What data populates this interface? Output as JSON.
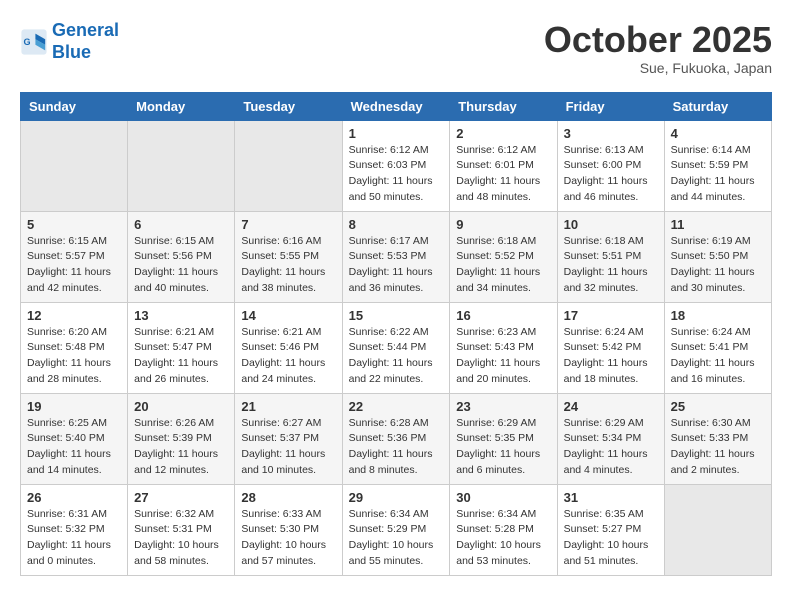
{
  "header": {
    "logo_line1": "General",
    "logo_line2": "Blue",
    "month": "October 2025",
    "location": "Sue, Fukuoka, Japan"
  },
  "days_of_week": [
    "Sunday",
    "Monday",
    "Tuesday",
    "Wednesday",
    "Thursday",
    "Friday",
    "Saturday"
  ],
  "weeks": [
    [
      {
        "day": "",
        "info": ""
      },
      {
        "day": "",
        "info": ""
      },
      {
        "day": "",
        "info": ""
      },
      {
        "day": "1",
        "info": "Sunrise: 6:12 AM\nSunset: 6:03 PM\nDaylight: 11 hours\nand 50 minutes."
      },
      {
        "day": "2",
        "info": "Sunrise: 6:12 AM\nSunset: 6:01 PM\nDaylight: 11 hours\nand 48 minutes."
      },
      {
        "day": "3",
        "info": "Sunrise: 6:13 AM\nSunset: 6:00 PM\nDaylight: 11 hours\nand 46 minutes."
      },
      {
        "day": "4",
        "info": "Sunrise: 6:14 AM\nSunset: 5:59 PM\nDaylight: 11 hours\nand 44 minutes."
      }
    ],
    [
      {
        "day": "5",
        "info": "Sunrise: 6:15 AM\nSunset: 5:57 PM\nDaylight: 11 hours\nand 42 minutes."
      },
      {
        "day": "6",
        "info": "Sunrise: 6:15 AM\nSunset: 5:56 PM\nDaylight: 11 hours\nand 40 minutes."
      },
      {
        "day": "7",
        "info": "Sunrise: 6:16 AM\nSunset: 5:55 PM\nDaylight: 11 hours\nand 38 minutes."
      },
      {
        "day": "8",
        "info": "Sunrise: 6:17 AM\nSunset: 5:53 PM\nDaylight: 11 hours\nand 36 minutes."
      },
      {
        "day": "9",
        "info": "Sunrise: 6:18 AM\nSunset: 5:52 PM\nDaylight: 11 hours\nand 34 minutes."
      },
      {
        "day": "10",
        "info": "Sunrise: 6:18 AM\nSunset: 5:51 PM\nDaylight: 11 hours\nand 32 minutes."
      },
      {
        "day": "11",
        "info": "Sunrise: 6:19 AM\nSunset: 5:50 PM\nDaylight: 11 hours\nand 30 minutes."
      }
    ],
    [
      {
        "day": "12",
        "info": "Sunrise: 6:20 AM\nSunset: 5:48 PM\nDaylight: 11 hours\nand 28 minutes."
      },
      {
        "day": "13",
        "info": "Sunrise: 6:21 AM\nSunset: 5:47 PM\nDaylight: 11 hours\nand 26 minutes."
      },
      {
        "day": "14",
        "info": "Sunrise: 6:21 AM\nSunset: 5:46 PM\nDaylight: 11 hours\nand 24 minutes."
      },
      {
        "day": "15",
        "info": "Sunrise: 6:22 AM\nSunset: 5:44 PM\nDaylight: 11 hours\nand 22 minutes."
      },
      {
        "day": "16",
        "info": "Sunrise: 6:23 AM\nSunset: 5:43 PM\nDaylight: 11 hours\nand 20 minutes."
      },
      {
        "day": "17",
        "info": "Sunrise: 6:24 AM\nSunset: 5:42 PM\nDaylight: 11 hours\nand 18 minutes."
      },
      {
        "day": "18",
        "info": "Sunrise: 6:24 AM\nSunset: 5:41 PM\nDaylight: 11 hours\nand 16 minutes."
      }
    ],
    [
      {
        "day": "19",
        "info": "Sunrise: 6:25 AM\nSunset: 5:40 PM\nDaylight: 11 hours\nand 14 minutes."
      },
      {
        "day": "20",
        "info": "Sunrise: 6:26 AM\nSunset: 5:39 PM\nDaylight: 11 hours\nand 12 minutes."
      },
      {
        "day": "21",
        "info": "Sunrise: 6:27 AM\nSunset: 5:37 PM\nDaylight: 11 hours\nand 10 minutes."
      },
      {
        "day": "22",
        "info": "Sunrise: 6:28 AM\nSunset: 5:36 PM\nDaylight: 11 hours\nand 8 minutes."
      },
      {
        "day": "23",
        "info": "Sunrise: 6:29 AM\nSunset: 5:35 PM\nDaylight: 11 hours\nand 6 minutes."
      },
      {
        "day": "24",
        "info": "Sunrise: 6:29 AM\nSunset: 5:34 PM\nDaylight: 11 hours\nand 4 minutes."
      },
      {
        "day": "25",
        "info": "Sunrise: 6:30 AM\nSunset: 5:33 PM\nDaylight: 11 hours\nand 2 minutes."
      }
    ],
    [
      {
        "day": "26",
        "info": "Sunrise: 6:31 AM\nSunset: 5:32 PM\nDaylight: 11 hours\nand 0 minutes."
      },
      {
        "day": "27",
        "info": "Sunrise: 6:32 AM\nSunset: 5:31 PM\nDaylight: 10 hours\nand 58 minutes."
      },
      {
        "day": "28",
        "info": "Sunrise: 6:33 AM\nSunset: 5:30 PM\nDaylight: 10 hours\nand 57 minutes."
      },
      {
        "day": "29",
        "info": "Sunrise: 6:34 AM\nSunset: 5:29 PM\nDaylight: 10 hours\nand 55 minutes."
      },
      {
        "day": "30",
        "info": "Sunrise: 6:34 AM\nSunset: 5:28 PM\nDaylight: 10 hours\nand 53 minutes."
      },
      {
        "day": "31",
        "info": "Sunrise: 6:35 AM\nSunset: 5:27 PM\nDaylight: 10 hours\nand 51 minutes."
      },
      {
        "day": "",
        "info": ""
      }
    ]
  ]
}
